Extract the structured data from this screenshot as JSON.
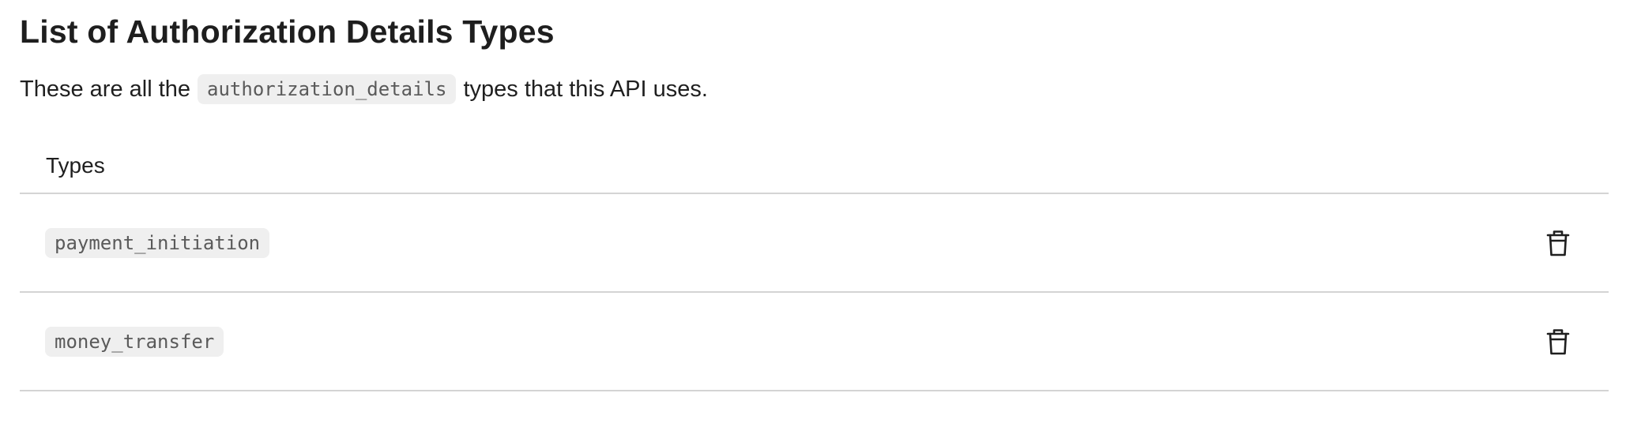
{
  "header": {
    "title": "List of Authorization Details Types",
    "description_before": "These are all the",
    "description_code": "authorization_details",
    "description_after": "types that this API uses."
  },
  "table": {
    "column_header": "Types",
    "rows": [
      {
        "type": "payment_initiation",
        "action_icon": "trash-icon"
      },
      {
        "type": "money_transfer",
        "action_icon": "trash-icon"
      }
    ]
  }
}
